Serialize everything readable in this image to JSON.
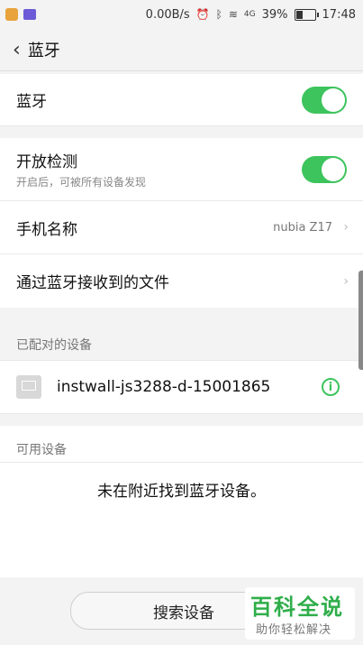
{
  "status_bar": {
    "speed": "0.00B/s",
    "network": "4G",
    "battery": "39%",
    "time": "17:48",
    "battery_level": 0.39
  },
  "header": {
    "back_icon": "chevron-left",
    "title": "蓝牙"
  },
  "bluetooth_row": {
    "label": "蓝牙",
    "toggle_on": true
  },
  "discover_row": {
    "label": "开放检测",
    "sublabel": "开启后，可被所有设备发现",
    "toggle_on": true
  },
  "phone_name_row": {
    "label": "手机名称",
    "value": "nubia Z17"
  },
  "received_files_row": {
    "label": "通过蓝牙接收到的文件"
  },
  "paired": {
    "header": "已配对的设备",
    "devices": [
      {
        "name": "instwall-js3288-d-15001865"
      }
    ]
  },
  "available": {
    "header": "可用设备",
    "empty_message": "未在附近找到蓝牙设备。"
  },
  "scan_button": {
    "label": "搜索设备"
  },
  "watermark": {
    "main": "百科全说",
    "sub": "助你轻松解决"
  },
  "colors": {
    "accent": "#3dc45d"
  }
}
